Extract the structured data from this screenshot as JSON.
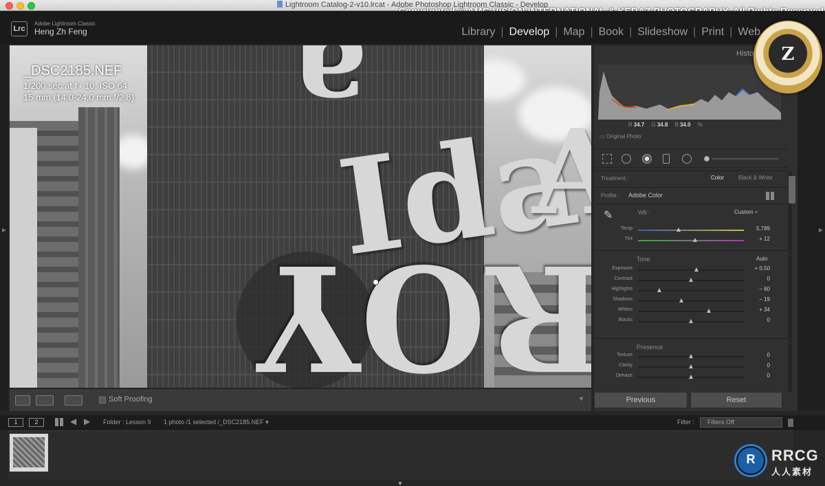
{
  "window": {
    "title": "Lightroom Catalog-2-v10.lrcat - Adobe Photoshop Lightroom Classic - Develop",
    "copyright": "Copyrighted © AMG VISION INTERNATIONAL & KEDAZ PHOTOGRAPHY. All Rights Reserved"
  },
  "identity": {
    "badge": "Lrc",
    "app_name": "Adobe Lightroom Classic",
    "user": "Heng Zh Feng"
  },
  "modules": [
    "Library",
    "Develop",
    "Map",
    "Book",
    "Slideshow",
    "Print",
    "Web"
  ],
  "active_module": "Develop",
  "photo_info": {
    "filename": "_DSC2185.NEF",
    "exposure": "1/200 sec at f / 10, ISO 64",
    "lens": "15 mm (14.0-24.0 mm f/2.8)"
  },
  "photo_sculpture_text": [
    "a",
    "Ida",
    "ROY",
    "A"
  ],
  "toolbar": {
    "soft_proofing": "Soft Proofing"
  },
  "histogram": {
    "title": "Histo",
    "r_label": "R",
    "r": "34.7",
    "g_label": "G",
    "g": "34.8",
    "b_label": "B",
    "b": "34.0",
    "unit": "%",
    "original_photo": "Original Photo"
  },
  "basic": {
    "treatment_label": "Treatment :",
    "treatment_color": "Color",
    "treatment_bw": "Black & White",
    "profile_label": "Profile :",
    "profile_value": "Adobe Color",
    "wb_label": "WB :",
    "wb_value": "Custom ÷",
    "tone_header": "Tone",
    "auto": "Auto",
    "presence_header": "Presence"
  },
  "wb_sliders": [
    {
      "label": "Temp",
      "value": "5,789",
      "pos": 0.38
    },
    {
      "label": "Tint",
      "value": "+ 12",
      "pos": 0.54
    }
  ],
  "tone_sliders": [
    {
      "label": "Exposure",
      "value": "+ 0.50",
      "pos": 0.55
    },
    {
      "label": "Contrast",
      "value": "0",
      "pos": 0.5
    },
    {
      "label": "Highlights",
      "value": "− 60",
      "pos": 0.2
    },
    {
      "label": "Shadows",
      "value": "− 19",
      "pos": 0.41
    },
    {
      "label": "Whites",
      "value": "+ 34",
      "pos": 0.67
    },
    {
      "label": "Blacks",
      "value": "0",
      "pos": 0.5
    }
  ],
  "presence_sliders": [
    {
      "label": "Texture",
      "value": "0",
      "pos": 0.5
    },
    {
      "label": "Clarity",
      "value": "0",
      "pos": 0.5
    },
    {
      "label": "Dehaze",
      "value": "0",
      "pos": 0.5
    }
  ],
  "buttons": {
    "previous": "Previous",
    "reset": "Reset"
  },
  "filmstrip_bar": {
    "view1": "1",
    "view2": "2",
    "folder": "Folder : Lesson 9",
    "selection": "1 photo /1 selected /_DSC2185.NEF ▾",
    "filter_label": "Filter :",
    "filter_value": "Filters Off"
  },
  "watermark": {
    "seal_letter": "Z",
    "brand": "RRCG",
    "brand_sub": "人人素材"
  }
}
